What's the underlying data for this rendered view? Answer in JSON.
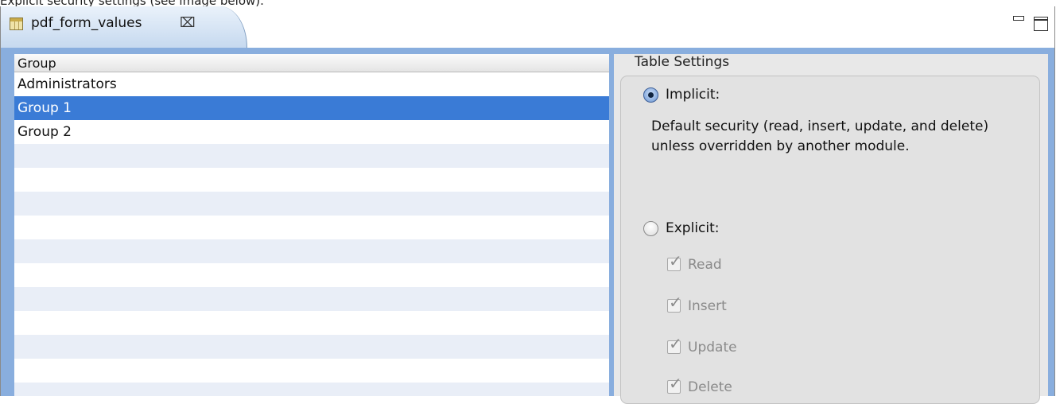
{
  "caption": "Explicit security settings (see image below).",
  "tab": {
    "title": "pdf_form_values",
    "close_glyph": "⌧",
    "icon": "table-icon"
  },
  "view_controls": {
    "minimize_icon": "minimize-icon",
    "maximize_icon": "maximize-icon"
  },
  "groups_table": {
    "header": "Group",
    "rows": [
      "Administrators",
      "Group 1",
      "Group 2"
    ],
    "selected": "Group 1"
  },
  "settings": {
    "title": "Table Settings",
    "implicit": {
      "label": "Implicit:",
      "checked": true,
      "description": "Default security (read, insert, update, and delete) unless overridden by another module."
    },
    "explicit": {
      "label": "Explicit:",
      "checked": false,
      "permissions": [
        {
          "label": "Read",
          "checked": true,
          "enabled": false
        },
        {
          "label": "Insert",
          "checked": true,
          "enabled": false
        },
        {
          "label": "Update",
          "checked": true,
          "enabled": false
        },
        {
          "label": "Delete",
          "checked": true,
          "enabled": false
        }
      ]
    }
  },
  "colors": {
    "selection": "#3a7bd6",
    "frame": "#89aede",
    "stripe": "#e9eef7"
  }
}
